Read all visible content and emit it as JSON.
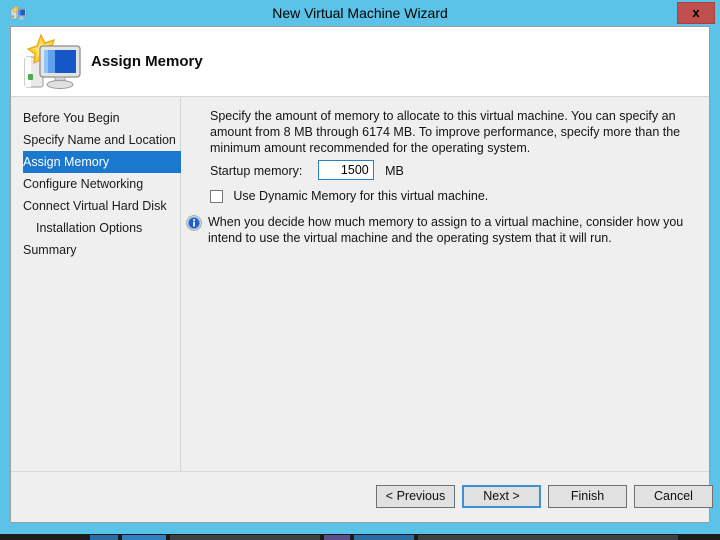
{
  "window": {
    "title": "New Virtual Machine Wizard",
    "title_icon": "vm-wizard-icon",
    "close_label": "x"
  },
  "header": {
    "title": "Assign Memory",
    "icon": "monitor-starburst-icon"
  },
  "sidebar": {
    "items": [
      {
        "label": "Before You Begin",
        "selected": false,
        "indent": false
      },
      {
        "label": "Specify Name and Location",
        "selected": false,
        "indent": false
      },
      {
        "label": "Assign Memory",
        "selected": true,
        "indent": false
      },
      {
        "label": "Configure Networking",
        "selected": false,
        "indent": false
      },
      {
        "label": "Connect Virtual Hard Disk",
        "selected": false,
        "indent": false
      },
      {
        "label": "Installation Options",
        "selected": false,
        "indent": true
      },
      {
        "label": "Summary",
        "selected": false,
        "indent": false
      }
    ]
  },
  "content": {
    "intro": "Specify the amount of memory to allocate to this virtual machine. You can specify an amount from 8 MB through 6174 MB. To improve performance, specify more than the minimum amount recommended for the operating system.",
    "startup_memory_label": "Startup memory:",
    "startup_memory_value": "1500",
    "startup_memory_unit": "MB",
    "dynamic_memory_label": "Use Dynamic Memory for this virtual machine.",
    "dynamic_memory_checked": false,
    "note_icon": "info-icon",
    "note": "When you decide how much memory to assign to a virtual machine, consider how you intend to use the virtual machine and the operating system that it will run."
  },
  "footer": {
    "previous_label": "< Previous",
    "next_label": "Next >",
    "finish_label": "Finish",
    "cancel_label": "Cancel",
    "default_button": "Next >"
  },
  "colors": {
    "window_frame": "#5bc3e8",
    "selection": "#1b78cf",
    "close_button": "#c0504d",
    "dialog_background": "#efefef",
    "focus_border": "#2a7fc9"
  }
}
